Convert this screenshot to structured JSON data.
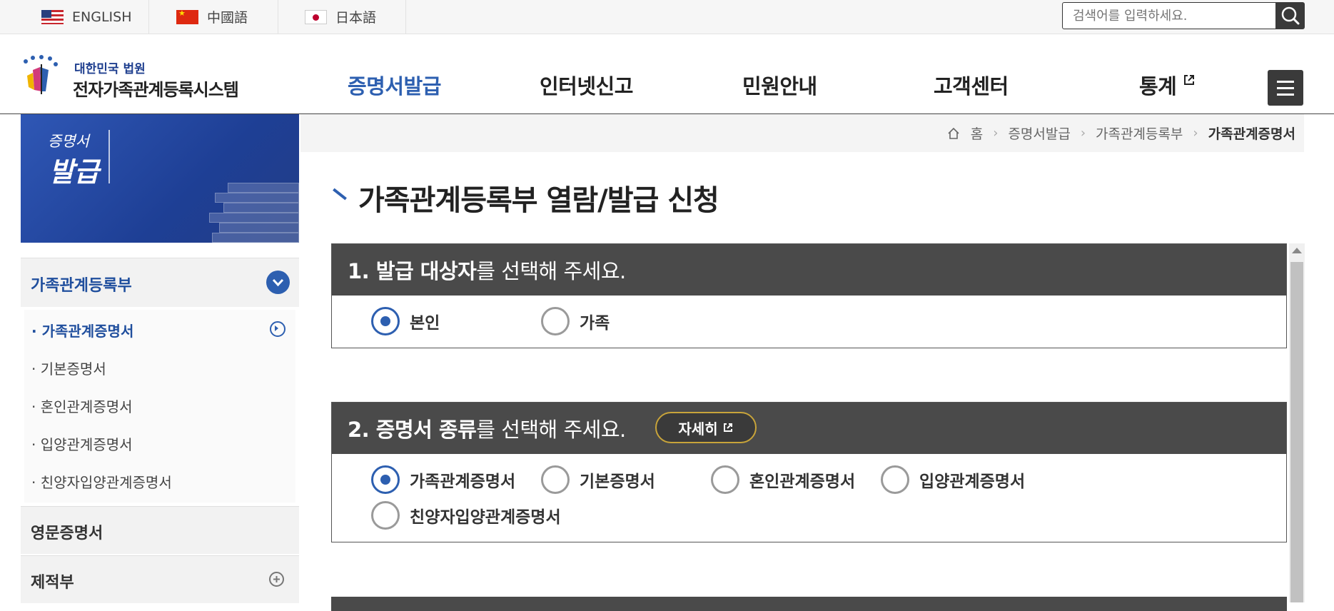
{
  "top": {
    "languages": [
      {
        "label": "ENGLISH",
        "flag": "us-flag-icon"
      },
      {
        "label": "中國語",
        "flag": "cn-flag-icon"
      },
      {
        "label": "日本語",
        "flag": "jp-flag-icon"
      }
    ],
    "search_placeholder": "검색어를 입력하세요."
  },
  "logo": {
    "line1": "대한민국 법원",
    "line2": "전자가족관계등록시스템"
  },
  "gnb": [
    {
      "label": "증명서발급",
      "active": true
    },
    {
      "label": "인터넷신고"
    },
    {
      "label": "민원안내"
    },
    {
      "label": "고객센터"
    },
    {
      "label": "통계"
    }
  ],
  "sidebar": {
    "banner_line1": "증명서",
    "banner_line2": "발급",
    "main_section": "가족관계등록부",
    "sub_items": [
      "가족관계증명서",
      "기본증명서",
      "혼인관계증명서",
      "입양관계증명서",
      "친양자입양관계증명서"
    ],
    "other_sections": [
      "영문증명서",
      "제적부"
    ]
  },
  "breadcrumb": [
    "홈",
    "증명서발급",
    "가족관계등록부",
    "가족관계증명서"
  ],
  "page_title": "가족관계등록부 열람/발급 신청",
  "step1": {
    "bold": "1. 발급 대상자",
    "rest": "를 선택해 주세요.",
    "options": [
      "본인",
      "가족"
    ],
    "selected": "본인"
  },
  "step2": {
    "bold": "2. 증명서 종류",
    "rest": "를 선택해 주세요.",
    "detail_label": "자세히",
    "options": [
      "가족관계증명서",
      "기본증명서",
      "혼인관계증명서",
      "입양관계증명서",
      "친양자입양관계증명서"
    ],
    "selected": "가족관계증명서"
  },
  "colors": {
    "accent": "#2d5fb0",
    "header_dark": "#4a4a4a",
    "detail_border": "#c8a43a"
  }
}
